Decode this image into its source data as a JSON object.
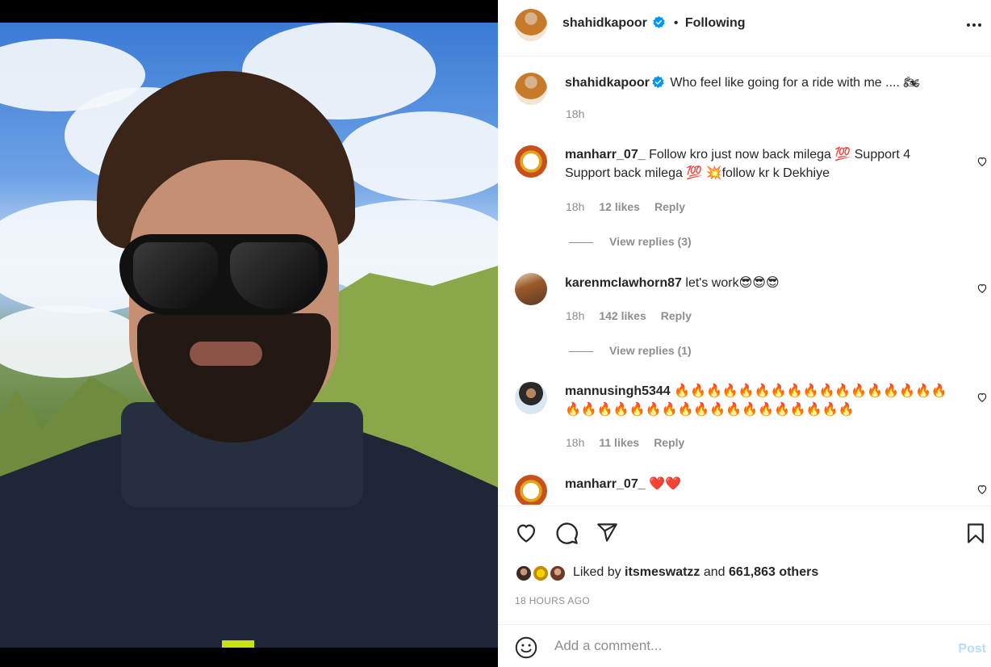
{
  "post": {
    "author": "shahidkapoor",
    "follow_sep": "•",
    "follow_status": "Following",
    "caption": "Who feel like going for a ride with me .... 🏍",
    "caption_time": "18h"
  },
  "comments": [
    {
      "user": "manharr_07_",
      "text": "Follow kro just now back milega 💯 Support 4 Support back milega 💯 💥follow kr k Dekhiye",
      "time": "18h",
      "likes": "12 likes",
      "reply": "Reply",
      "view_replies": "View replies (3)"
    },
    {
      "user": "karenmclawhorn87",
      "text": "let's work😎😎😎",
      "time": "18h",
      "likes": "142 likes",
      "reply": "Reply",
      "view_replies": "View replies (1)"
    },
    {
      "user": "mannusingh5344",
      "text": "🔥🔥🔥🔥🔥🔥🔥🔥🔥🔥🔥🔥🔥🔥🔥🔥🔥🔥🔥🔥🔥🔥🔥🔥🔥🔥🔥🔥🔥🔥🔥🔥🔥🔥🔥",
      "time": "18h",
      "likes": "11 likes",
      "reply": "Reply"
    },
    {
      "user": "manharr_07_",
      "text": "❤️❤️"
    }
  ],
  "likes": {
    "prefix": "Liked by",
    "user": "itsmeswatzz",
    "and": "and",
    "others": "661,863 others"
  },
  "timestamp": "18 HOURS AGO",
  "add_comment": {
    "placeholder": "Add a comment...",
    "post_label": "Post"
  },
  "icons": [
    "more-options-icon",
    "verified-badge-icon",
    "heart-icon",
    "comment-icon",
    "share-icon",
    "bookmark-icon",
    "emoji-icon"
  ],
  "colors": {
    "verified": "#0095f6",
    "link_disabled": "#b2dffc",
    "muted": "#8e8e8e",
    "text": "#262626"
  }
}
